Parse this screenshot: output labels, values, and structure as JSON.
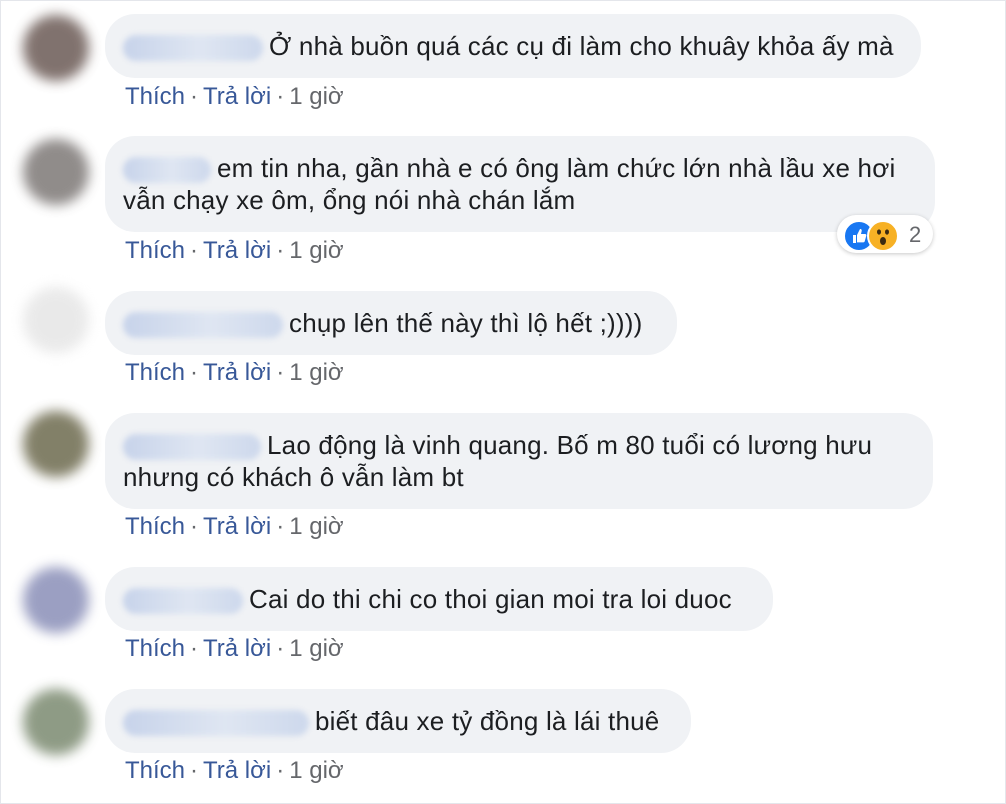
{
  "comments": [
    {
      "author_name": "",
      "lines": [
        "Ở nhà buồn quá các cụ đi làm cho khuây khỏa ấy mà"
      ],
      "like_label": "Thích",
      "reply_label": "Trả lời",
      "time": "1 giờ",
      "avatar_color": "#6b5a55"
    },
    {
      "author_name": "",
      "lines": [
        "em tin nha, gần nhà e có ông làm chức lớn nhà lầu xe hơi",
        "vẫn chạy xe ôm, ổng nói nhà chán lắm"
      ],
      "like_label": "Thích",
      "reply_label": "Trả lời",
      "time": "1 giờ",
      "avatar_color": "#7d7876",
      "reactions": {
        "count": "2",
        "types": [
          "like-icon",
          "wow-icon"
        ]
      }
    },
    {
      "author_name": "",
      "lines": [
        "chụp lên thế này thì lộ hết ;))))"
      ],
      "like_label": "Thích",
      "reply_label": "Trả lời",
      "time": "1 giờ",
      "avatar_color": "#e6e6e6"
    },
    {
      "author_name": "",
      "lines": [
        "Lao động là vinh quang. Bố m 80 tuổi có lương hưu",
        "nhưng có khách ô vẫn làm bt"
      ],
      "like_label": "Thích",
      "reply_label": "Trả lời",
      "time": "1 giờ",
      "avatar_color": "#6d6a4e"
    },
    {
      "author_name": "",
      "lines": [
        "Cai do thi chi co thoi gian moi tra loi duoc"
      ],
      "like_label": "Thích",
      "reply_label": "Trả lời",
      "time": "1 giờ",
      "avatar_color": "#8a8fb8"
    },
    {
      "author_name": "",
      "lines": [
        "biết đâu xe tỷ đồng là lái thuê"
      ],
      "like_label": "Thích",
      "reply_label": "Trả lời",
      "time": "1 giờ",
      "avatar_color": "#7b8a70"
    }
  ],
  "colors": {
    "bubble": "#f0f2f5",
    "link": "#385898",
    "meta": "#65676b",
    "like_reaction": "#1877f2",
    "wow_reaction": "#f7b125"
  }
}
